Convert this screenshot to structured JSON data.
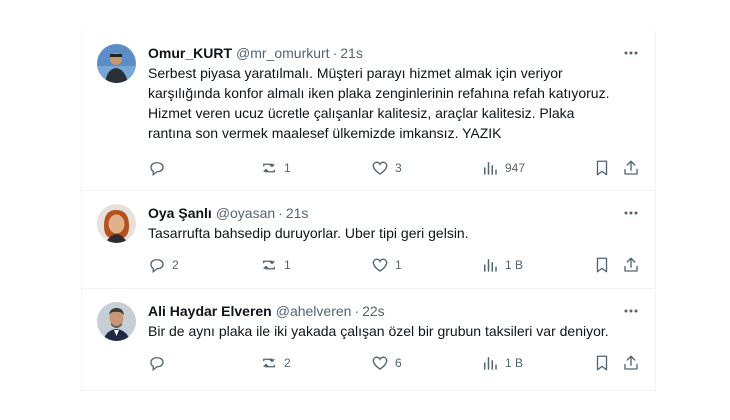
{
  "tweets": [
    {
      "name": "Omur_KURT",
      "handle": "@mr_omurkurt",
      "separator": "·",
      "time": "21s",
      "text": "Serbest piyasa yaratılmalı. Müşteri parayı hizmet almak için veriyor karşılığında konfor almalı iken plaka zenginlerinin refahına refah katıyoruz. Hizmet veren ucuz ücretle çalışanlar kalitesiz, araçlar kalitesiz. Plaka rantına son vermek maalesef ülkemizde imkansız. YAZIK",
      "replies": "",
      "retweets": "1",
      "likes": "3",
      "views": "947"
    },
    {
      "name": "Oya Şanlı",
      "handle": "@oyasan",
      "separator": "·",
      "time": "21s",
      "text": "Tasarrufta bahsedip duruyorlar. Uber tipi geri gelsin.",
      "replies": "2",
      "retweets": "1",
      "likes": "1",
      "views": "1 B"
    },
    {
      "name": "Ali Haydar Elveren",
      "handle": "@ahelveren",
      "separator": "·",
      "time": "22s",
      "text": "Bir de aynı plaka ile iki yakada çalışan özel bir grubun taksileri var deniyor.",
      "replies": "",
      "retweets": "2",
      "likes": "6",
      "views": "1 B"
    }
  ],
  "colors": {
    "text": "#0f1419",
    "muted": "#536471",
    "border": "#eff3f4"
  },
  "icons": [
    "more-icon",
    "reply-icon",
    "retweet-icon",
    "like-icon",
    "views-icon",
    "bookmark-icon",
    "share-icon"
  ]
}
